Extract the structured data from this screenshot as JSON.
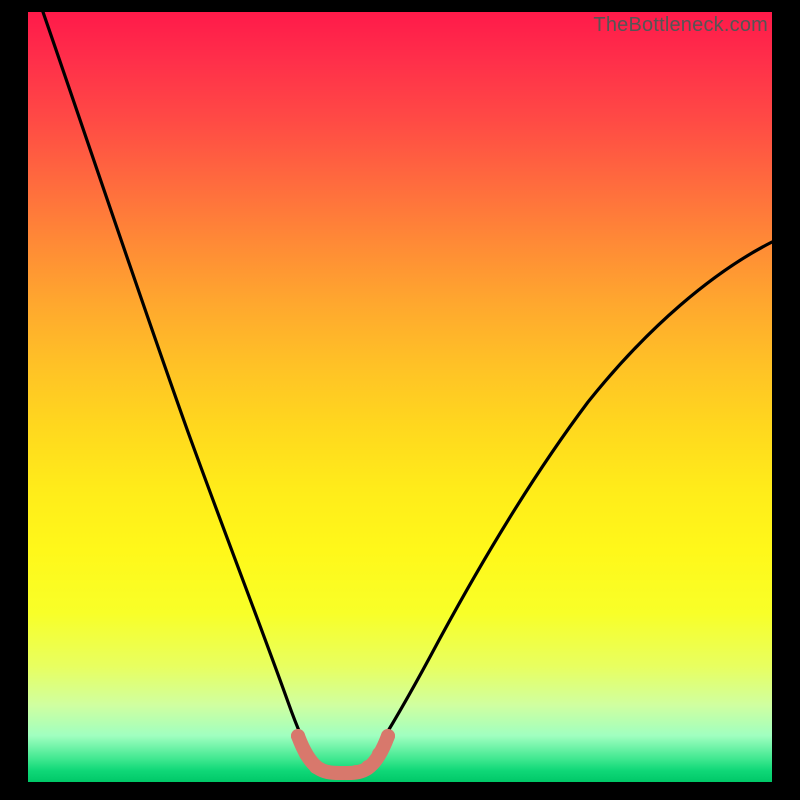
{
  "watermark": "TheBottleneck.com",
  "chart_data": {
    "type": "line",
    "title": "",
    "xlabel": "",
    "ylabel": "",
    "xlim": [
      0,
      100
    ],
    "ylim": [
      0,
      100
    ],
    "series": [
      {
        "name": "curve-left",
        "x": [
          2,
          6,
          10,
          14,
          18,
          22,
          26,
          30,
          33,
          35,
          36.5,
          37.5
        ],
        "y": [
          100,
          86,
          72,
          59,
          46,
          35,
          25,
          16,
          9,
          5,
          3,
          2
        ]
      },
      {
        "name": "curve-right",
        "x": [
          45,
          47,
          50,
          54,
          58,
          62,
          66,
          70,
          74,
          78,
          82,
          86,
          90,
          94,
          98,
          100
        ],
        "y": [
          2,
          3,
          5,
          8,
          12,
          17,
          22,
          27,
          33,
          38,
          44,
          49,
          54,
          59,
          63,
          66
        ]
      },
      {
        "name": "highlight-bracket",
        "x": [
          35.5,
          36.5,
          37.5,
          38.5,
          40,
          42,
          44,
          45.5,
          46.5,
          47.5
        ],
        "y": [
          5.2,
          3.4,
          2.2,
          1.6,
          1.4,
          1.4,
          1.6,
          2.2,
          3.4,
          5.2
        ]
      }
    ],
    "colors": {
      "curve": "#000000",
      "highlight": "#d8786c",
      "background_top": "#ff1a4a",
      "background_bottom": "#00c868"
    }
  }
}
